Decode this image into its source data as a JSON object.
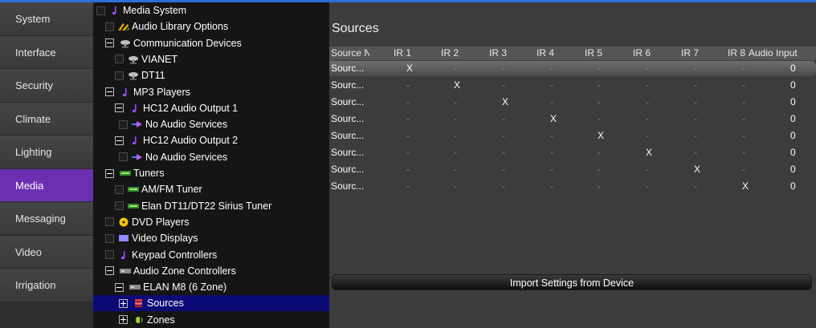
{
  "sidebar": {
    "items": [
      {
        "label": "System",
        "active": false
      },
      {
        "label": "Interface",
        "active": false
      },
      {
        "label": "Security",
        "active": false
      },
      {
        "label": "Climate",
        "active": false
      },
      {
        "label": "Lighting",
        "active": false
      },
      {
        "label": "Media",
        "active": true
      },
      {
        "label": "Messaging",
        "active": false
      },
      {
        "label": "Video",
        "active": false
      },
      {
        "label": "Irrigation",
        "active": false
      }
    ]
  },
  "tree": {
    "nodes": [
      {
        "label": "Media System",
        "icon": "music-note-icon",
        "depth": 0,
        "expander": "none"
      },
      {
        "label": "Audio Library Options",
        "icon": "audio-library-icon",
        "depth": 1,
        "expander": "none"
      },
      {
        "label": "Communication Devices",
        "icon": "satellite-dish-icon",
        "depth": 1,
        "expander": "minus"
      },
      {
        "label": "VIANET",
        "icon": "satellite-dish-icon",
        "depth": 2,
        "expander": "none"
      },
      {
        "label": "DT11",
        "icon": "satellite-dish-icon",
        "depth": 2,
        "expander": "none"
      },
      {
        "label": "MP3 Players",
        "icon": "music-note-icon",
        "depth": 1,
        "expander": "minus"
      },
      {
        "label": "HC12  Audio Output 1",
        "icon": "music-note-icon",
        "depth": 2,
        "expander": "minus"
      },
      {
        "label": "No Audio Services",
        "icon": "arrow-right-icon",
        "depth": 3,
        "expander": "none"
      },
      {
        "label": "HC12 Audio Output 2",
        "icon": "music-note-icon",
        "depth": 2,
        "expander": "minus"
      },
      {
        "label": "No Audio Services",
        "icon": "arrow-right-icon",
        "depth": 3,
        "expander": "none"
      },
      {
        "label": "Tuners",
        "icon": "tuner-icon",
        "depth": 1,
        "expander": "minus"
      },
      {
        "label": "AM/FM Tuner",
        "icon": "tuner-icon",
        "depth": 2,
        "expander": "none"
      },
      {
        "label": "Elan DT11/DT22 Sirius Tuner",
        "icon": "tuner-icon",
        "depth": 2,
        "expander": "none"
      },
      {
        "label": "DVD Players",
        "icon": "dvd-disc-icon",
        "depth": 1,
        "expander": "none"
      },
      {
        "label": "Video Displays",
        "icon": "video-display-icon",
        "depth": 1,
        "expander": "none"
      },
      {
        "label": "Keypad Controllers",
        "icon": "music-note-icon",
        "depth": 1,
        "expander": "none"
      },
      {
        "label": "Audio Zone Controllers",
        "icon": "controller-icon",
        "depth": 1,
        "expander": "minus"
      },
      {
        "label": "ELAN M8 (6 Zone)",
        "icon": "controller-icon",
        "depth": 2,
        "expander": "minus"
      },
      {
        "label": "Sources",
        "icon": "sources-icon",
        "depth": 3,
        "expander": "plus",
        "selected": true
      },
      {
        "label": "Zones",
        "icon": "zones-icon",
        "depth": 3,
        "expander": "plus"
      }
    ]
  },
  "main": {
    "title": "Sources",
    "columns": [
      "Source Na",
      "IR 1",
      "IR 2",
      "IR 3",
      "IR 4",
      "IR 5",
      "IR 6",
      "IR 7",
      "IR 8",
      "Audio Input"
    ],
    "rows": [
      [
        "Sourc...",
        "X",
        "-",
        "-",
        "-",
        "-",
        "-",
        "-",
        "-",
        "0"
      ],
      [
        "Sourc...",
        "-",
        "X",
        "-",
        "-",
        "-",
        "-",
        "-",
        "-",
        "0"
      ],
      [
        "Sourc...",
        "-",
        "-",
        "X",
        "-",
        "-",
        "-",
        "-",
        "-",
        "0"
      ],
      [
        "Sourc...",
        "-",
        "-",
        "-",
        "X",
        "-",
        "-",
        "-",
        "-",
        "0"
      ],
      [
        "Sourc...",
        "-",
        "-",
        "-",
        "-",
        "X",
        "-",
        "-",
        "-",
        "0"
      ],
      [
        "Sourc...",
        "-",
        "-",
        "-",
        "-",
        "-",
        "X",
        "-",
        "-",
        "0"
      ],
      [
        "Sourc...",
        "-",
        "-",
        "-",
        "-",
        "-",
        "-",
        "X",
        "-",
        "0"
      ],
      [
        "Sourc...",
        "-",
        "-",
        "-",
        "-",
        "-",
        "-",
        "-",
        "X",
        "0"
      ]
    ],
    "import_button": "Import Settings from Device"
  },
  "colors": {
    "accent": "#6c2fb2",
    "selection": "#0b0b78",
    "top_bar": "#2d6fd6"
  }
}
